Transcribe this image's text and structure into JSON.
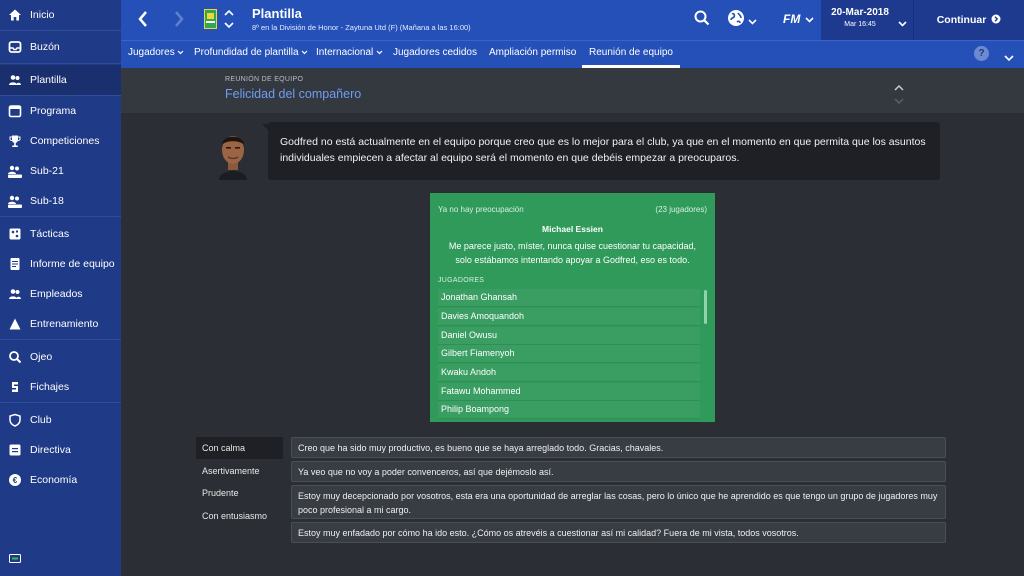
{
  "sidebar": {
    "items": [
      {
        "label": "Inicio",
        "icon": "home-icon"
      },
      {
        "label": "Buzón",
        "icon": "inbox-icon"
      },
      {
        "label": "Plantilla",
        "icon": "squad-icon"
      },
      {
        "label": "Programa",
        "icon": "calendar-icon"
      },
      {
        "label": "Competiciones",
        "icon": "trophy-icon"
      },
      {
        "label": "Sub-21",
        "icon": "squad-u21-icon"
      },
      {
        "label": "Sub-18",
        "icon": "squad-u18-icon"
      },
      {
        "label": "Tácticas",
        "icon": "tactics-icon"
      },
      {
        "label": "Informe de equipo",
        "icon": "report-icon"
      },
      {
        "label": "Empleados",
        "icon": "staff-icon"
      },
      {
        "label": "Entrenamiento",
        "icon": "training-icon"
      },
      {
        "label": "Ojeo",
        "icon": "scouting-icon"
      },
      {
        "label": "Fichajes",
        "icon": "transfers-icon"
      },
      {
        "label": "Club",
        "icon": "club-icon"
      },
      {
        "label": "Directiva",
        "icon": "board-icon"
      },
      {
        "label": "Economía",
        "icon": "finances-icon"
      }
    ]
  },
  "header": {
    "title": "Plantilla",
    "subtitle": "8º en la División de Honor - Zaytuna Utd (F) (Mañana a las 16:00)",
    "date": "20-Mar-2018",
    "time": "Mar 16:45",
    "fm_logo": "FM",
    "continue_label": "Continuar"
  },
  "tabs": [
    {
      "label": "Jugadores",
      "dropdown": true
    },
    {
      "label": "Profundidad de plantilla",
      "dropdown": true
    },
    {
      "label": "Internacional",
      "dropdown": true
    },
    {
      "label": "Jugadores cedidos",
      "dropdown": false
    },
    {
      "label": "Ampliación permiso",
      "dropdown": false
    },
    {
      "label": "Reunión de equipo",
      "dropdown": false
    }
  ],
  "help_label": "?",
  "section": {
    "kicker": "REUNIÓN DE EQUIPO",
    "title": "Felicidad del compañero"
  },
  "speech": "Godfred no está actualmente en el equipo porque creo que es lo mejor para el club, ya que en el momento en que permita que los asuntos individuales empiecen a afectar al equipo será el momento en que debéis empezar a preocuparos.",
  "panel": {
    "status": "Ya no hay preocupación",
    "count": "(23 jugadores)",
    "speaker": "Michael Essien",
    "quote": "Me parece justo, míster, nunca quise cuestionar tu capacidad, solo estábamos intentando apoyar a Godfred, eso es todo.",
    "list_heading": "JUGADORES",
    "players": [
      "Jonathan Ghansah",
      "Davies Amoquandoh",
      "Daniel Owusu",
      "Gilbert Fiamenyoh",
      "Kwaku Andoh",
      "Fatawu Mohammed",
      "Philip Boampong"
    ]
  },
  "tones": [
    "Con calma",
    "Asertivamente",
    "Prudente",
    "Con entusiasmo"
  ],
  "replies": [
    "Creo que ha sido muy productivo, es bueno que se haya arreglado todo. Gracias, chavales.",
    "Ya veo que no voy a poder convenceros, así que dejémoslo así.",
    "Estoy muy decepcionado por vosotros, esta era una oportunidad de arreglar las cosas, pero lo único que he aprendido es que tengo un grupo de jugadores muy poco profesional a mi cargo.",
    "Estoy muy enfadado por cómo ha ido esto. ¿Cómo os atrevéis a cuestionar así mi calidad? Fuera de mi vista, todos vosotros."
  ],
  "colors": {
    "sidebar": "#1f3a86",
    "header": "#2450b8",
    "accent_title": "#6f9df2",
    "panel_green": "#2f9a5a"
  }
}
